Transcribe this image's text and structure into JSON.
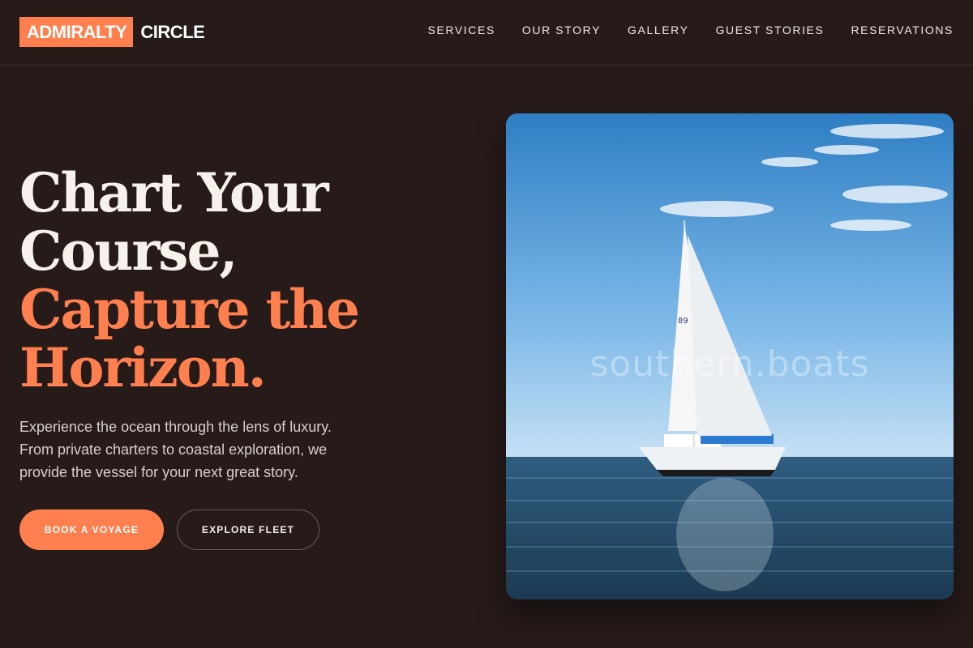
{
  "brand": {
    "name_boxed": "ADMIRALTY",
    "name_plain": "CIRCLE",
    "accent_color": "#ff7f4f"
  },
  "nav": {
    "items": [
      {
        "label": "SERVICES"
      },
      {
        "label": "OUR STORY"
      },
      {
        "label": "GALLERY"
      },
      {
        "label": "GUEST STORIES"
      },
      {
        "label": "RESERVATIONS"
      }
    ]
  },
  "hero": {
    "title_line1": "Chart Your",
    "title_line2": "Course,",
    "title_line3": "Capture the",
    "title_line4": "Horizon.",
    "description": "Experience the ocean through the lens of luxury. From private charters to coastal exploration, we provide the vessel for your next great story.",
    "primary_button": "BOOK A VOYAGE",
    "secondary_button": "EXPLORE FLEET"
  },
  "image": {
    "subject": "sailboat-on-open-sea",
    "watermark": "southern.boats",
    "sail_number": "89"
  },
  "colors": {
    "background": "#271b1a",
    "text": "#f5efe8",
    "accent": "#ff7f4f"
  }
}
